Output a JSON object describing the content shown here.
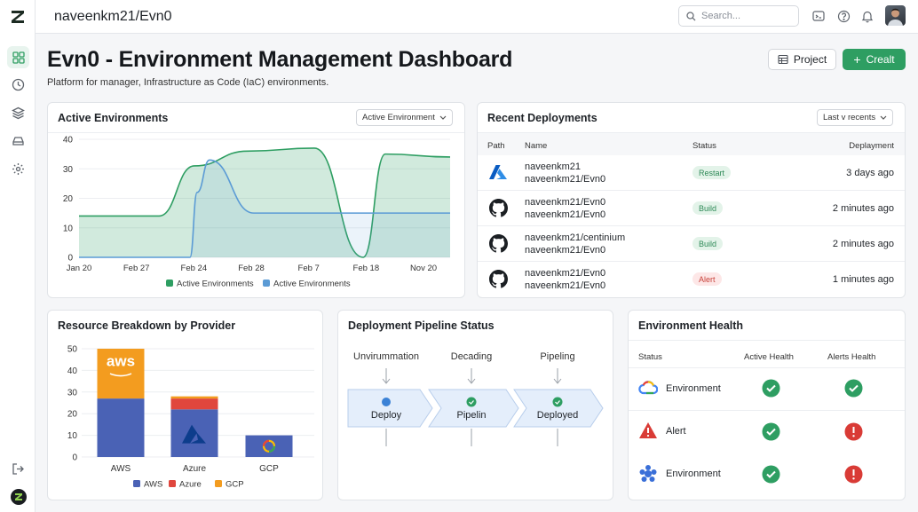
{
  "header": {
    "repo": "naveenkm21/Evn0",
    "search_placeholder": "Search..."
  },
  "page": {
    "title": "Evn0 - Environment Management Dashboard",
    "subtitle": "Platform for manager, Infrastructure as Code (IaC) environments.",
    "project_button": "Project",
    "create_button": "Crealt"
  },
  "active_env": {
    "title": "Active Environments",
    "dropdown": "Active Environment"
  },
  "recent_deployments": {
    "title": "Recent Deployments",
    "dropdown": "Last v recents",
    "columns": {
      "path": "Path",
      "name": "Name",
      "status": "Status",
      "deployment": "Deplayment"
    },
    "rows": [
      {
        "icon": "azure-icon",
        "name1": "naveenkm21",
        "name2": "naveenkm21/Evn0",
        "status": "Restart",
        "time": "3 days ago"
      },
      {
        "icon": "github-icon",
        "name1": "naveenkm21/Evn0",
        "name2": "naveenkm21/Evn0",
        "status": "Build",
        "time": "2 minutes ago"
      },
      {
        "icon": "github-icon",
        "name1": "naveenkm21/centinium",
        "name2": "naveenkm21/Evn0",
        "status": "Build",
        "time": "2 minutes ago"
      },
      {
        "icon": "github-icon",
        "name1": "naveenkm21/Evn0",
        "name2": "naveenkm21/Evn0",
        "status": "Alert",
        "time": "1 minutes ago"
      }
    ],
    "colors": {
      "build": "#2e8a57",
      "restart": "#2e8a57",
      "alert": "#c8423a"
    }
  },
  "resource": {
    "title": "Resource Breakdown by Provider",
    "aws_logo_text": "aws"
  },
  "pipeline": {
    "title": "Deployment Pipeline Status",
    "stages": [
      {
        "label": "Unvirummation",
        "box": "Deploy",
        "status": "info"
      },
      {
        "label": "Decading",
        "box": "Pipelin",
        "status": "ok"
      },
      {
        "label": "Pipeling",
        "box": "Deployed",
        "status": "ok"
      }
    ]
  },
  "health": {
    "title": "Environment Health",
    "columns": {
      "status": "Status",
      "active": "Active Health",
      "alerts": "Alerts Health"
    },
    "rows": [
      {
        "icon": "gcp-cloud-icon",
        "label": "Environment",
        "active": "ok",
        "alerts": "ok"
      },
      {
        "icon": "warning-icon",
        "label": "Alert",
        "active": "ok",
        "alerts": "error"
      },
      {
        "icon": "kubernetes-icon",
        "label": "Environment",
        "active": "ok",
        "alerts": "error"
      }
    ],
    "colors": {
      "ok": "#2e9e62",
      "error": "#d93b36"
    }
  },
  "chart_data": [
    {
      "type": "area",
      "x": [
        "Jan 20",
        "Feb 27",
        "Feb 24",
        "Feb 28",
        "Feb 7",
        "Feb 18",
        "Nov 20"
      ],
      "ylim": [
        0,
        40
      ],
      "yticks": [
        0,
        10,
        20,
        30,
        40
      ],
      "series": [
        {
          "name": "Active Environments",
          "color": "#2e9e62",
          "values": [
            14,
            14,
            31,
            36,
            37,
            0,
            35,
            34
          ]
        },
        {
          "name": "Active Environments",
          "color": "#5b9bd5",
          "values": [
            0,
            0,
            0,
            33,
            15,
            15,
            15,
            15
          ]
        }
      ]
    },
    {
      "type": "bar",
      "stacked": true,
      "categories": [
        "AWS",
        "Azure",
        "GCP"
      ],
      "ylim": [
        0,
        50
      ],
      "yticks": [
        0,
        10,
        20,
        30,
        40,
        50
      ],
      "series": [
        {
          "name": "AWS",
          "color": "#4a62b5",
          "values": [
            27,
            22,
            10
          ]
        },
        {
          "name": "Azure",
          "color": "#e0463d",
          "values": [
            0,
            5,
            0
          ]
        },
        {
          "name": "GCP",
          "color": "#f39c1f",
          "values": [
            23,
            1,
            0
          ]
        }
      ]
    }
  ]
}
